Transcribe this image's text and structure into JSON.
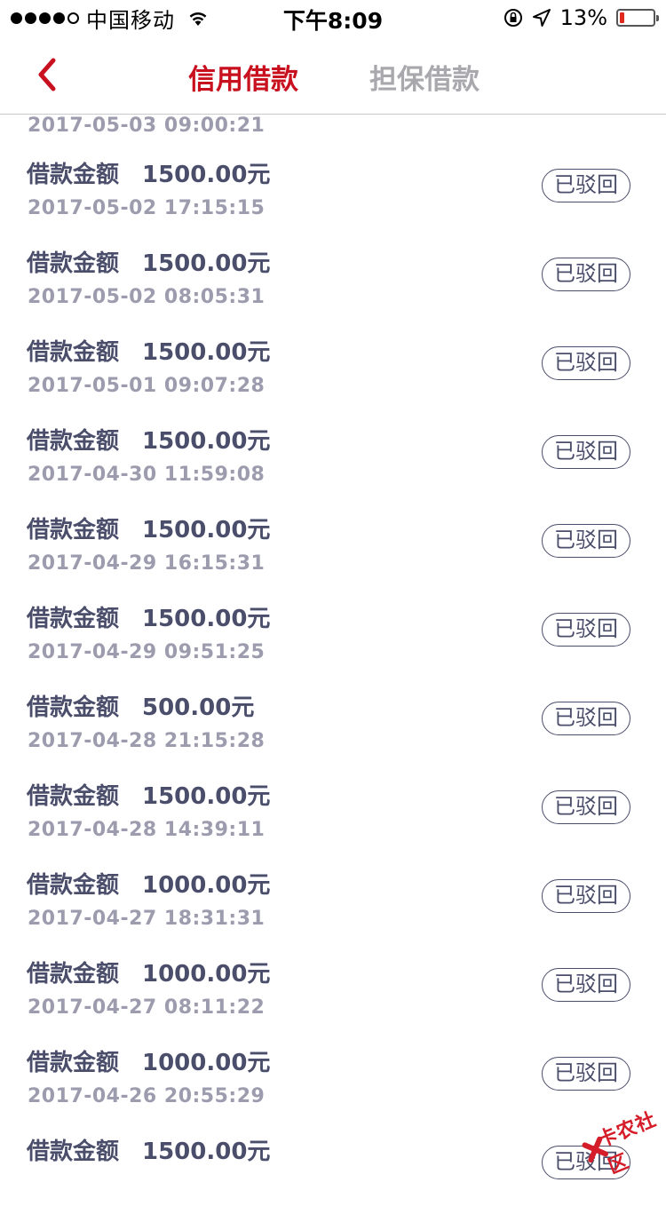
{
  "status_bar": {
    "carrier": "中国移动",
    "time": "下午8:09",
    "battery_percent": "13%",
    "battery_level": 0.13,
    "signal_bars": 4
  },
  "nav": {
    "tab_active": "信用借款",
    "tab_inactive": "担保借款"
  },
  "list": {
    "partial_top_date": "2017-05-03 09:00:21",
    "items": [
      {
        "label": "借款金额",
        "amount": "1500.00元",
        "date": "2017-05-02 17:15:15",
        "status": "已驳回"
      },
      {
        "label": "借款金额",
        "amount": "1500.00元",
        "date": "2017-05-02 08:05:31",
        "status": "已驳回"
      },
      {
        "label": "借款金额",
        "amount": "1500.00元",
        "date": "2017-05-01 09:07:28",
        "status": "已驳回"
      },
      {
        "label": "借款金额",
        "amount": "1500.00元",
        "date": "2017-04-30 11:59:08",
        "status": "已驳回"
      },
      {
        "label": "借款金额",
        "amount": "1500.00元",
        "date": "2017-04-29 16:15:31",
        "status": "已驳回"
      },
      {
        "label": "借款金额",
        "amount": "1500.00元",
        "date": "2017-04-29 09:51:25",
        "status": "已驳回"
      },
      {
        "label": "借款金额",
        "amount": "500.00元",
        "date": "2017-04-28 21:15:28",
        "status": "已驳回"
      },
      {
        "label": "借款金额",
        "amount": "1500.00元",
        "date": "2017-04-28 14:39:11",
        "status": "已驳回"
      },
      {
        "label": "借款金额",
        "amount": "1000.00元",
        "date": "2017-04-27 18:31:31",
        "status": "已驳回"
      },
      {
        "label": "借款金额",
        "amount": "1000.00元",
        "date": "2017-04-27 08:11:22",
        "status": "已驳回"
      },
      {
        "label": "借款金额",
        "amount": "1000.00元",
        "date": "2017-04-26 20:55:29",
        "status": "已驳回"
      },
      {
        "label": "借款金额",
        "amount": "1500.00元",
        "date": "",
        "status": "已驳回"
      }
    ]
  },
  "watermark": {
    "text": "卡农社区"
  },
  "colors": {
    "accent": "#c8101e",
    "text": "#4b4e6b",
    "muted": "#9c9cae",
    "inactive_tab": "#a8a8ad"
  }
}
